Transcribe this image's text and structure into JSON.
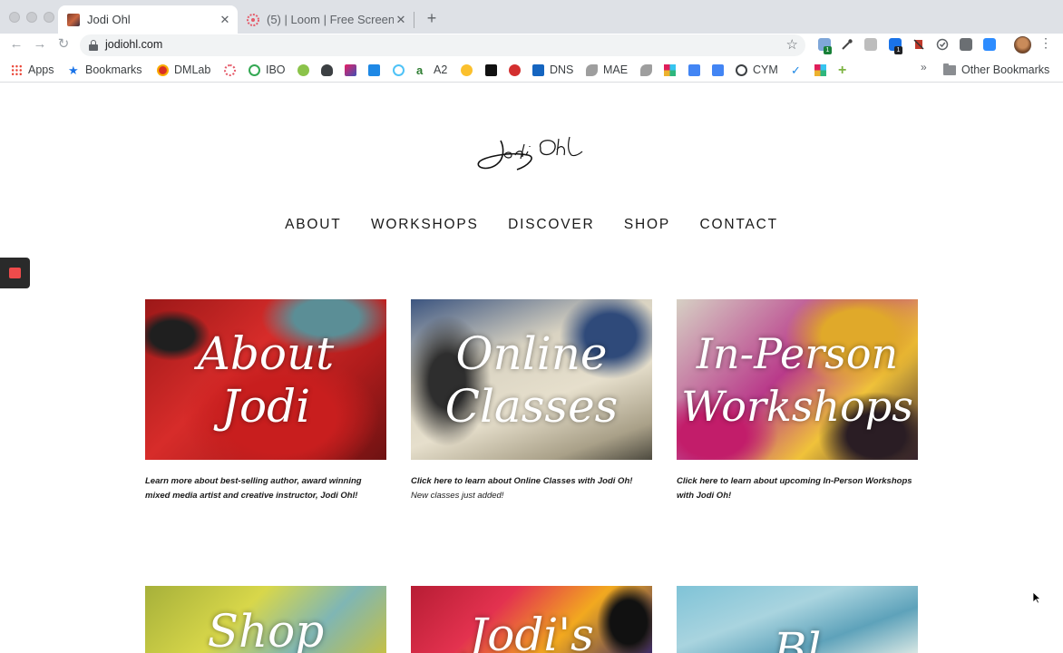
{
  "browser": {
    "tabs": [
      {
        "title": "Jodi Ohl",
        "active": true
      },
      {
        "title": "(5) | Loom | Free Screen",
        "active": false
      }
    ],
    "url": "jodiohl.com",
    "bookmarks": [
      {
        "label": "Apps",
        "icon": "apps-grid-icon"
      },
      {
        "label": "Bookmarks",
        "icon": "star-icon"
      },
      {
        "label": "DMLab",
        "icon": "dmlab-icon"
      },
      {
        "label": "",
        "icon": "loom-icon"
      },
      {
        "label": "IBO",
        "icon": "ibo-icon"
      },
      {
        "label": "",
        "icon": "v-icon"
      },
      {
        "label": "",
        "icon": "octopus-icon"
      },
      {
        "label": "",
        "icon": "square-icon"
      },
      {
        "label": "",
        "icon": "arrow-icon"
      },
      {
        "label": "",
        "icon": "circle-icon"
      },
      {
        "label": "A2",
        "icon": "a2-icon"
      },
      {
        "label": "",
        "icon": "coin-icon"
      },
      {
        "label": "",
        "icon": "g-icon"
      },
      {
        "label": "",
        "icon": "w-icon"
      },
      {
        "label": "DNS",
        "icon": "dns-icon"
      },
      {
        "label": "MAE",
        "icon": "mae-icon"
      },
      {
        "label": "",
        "icon": "leaf-icon"
      },
      {
        "label": "",
        "icon": "slack-icon"
      },
      {
        "label": "",
        "icon": "doc-icon"
      },
      {
        "label": "",
        "icon": "doc-icon"
      },
      {
        "label": "CYM",
        "icon": "globe-icon"
      },
      {
        "label": "",
        "icon": "tick-icon"
      },
      {
        "label": "",
        "icon": "slack-icon"
      },
      {
        "label": "",
        "icon": "plus-icon"
      }
    ],
    "more_label": "»",
    "other_bookmarks": "Other Bookmarks",
    "extension_badges": [
      "1",
      "1"
    ]
  },
  "site": {
    "nav": [
      "ABOUT",
      "WORKSHOPS",
      "DISCOVER",
      "SHOP",
      "CONTACT"
    ],
    "cards": [
      {
        "lines": [
          "About",
          "Jodi"
        ],
        "desc": "Learn more about best-selling author, award winning mixed media artist and creative instructor, Jodi Ohl!",
        "sub": ""
      },
      {
        "lines": [
          "Online",
          "Classes"
        ],
        "desc": "Click here to learn about Online Classes with Jodi Oh!",
        "sub": "New classes just added!"
      },
      {
        "lines": [
          "In-Person",
          "Workshops"
        ],
        "desc": "Click here to learn about upcoming In-Person Workshops with Jodi Oh!",
        "sub": ""
      },
      {
        "lines": [
          "Shop",
          ""
        ],
        "desc": "",
        "sub": ""
      },
      {
        "lines": [
          "Jodi's",
          ""
        ],
        "desc": "",
        "sub": ""
      },
      {
        "lines": [
          "Bl",
          ""
        ],
        "desc": "",
        "sub": ""
      }
    ]
  }
}
